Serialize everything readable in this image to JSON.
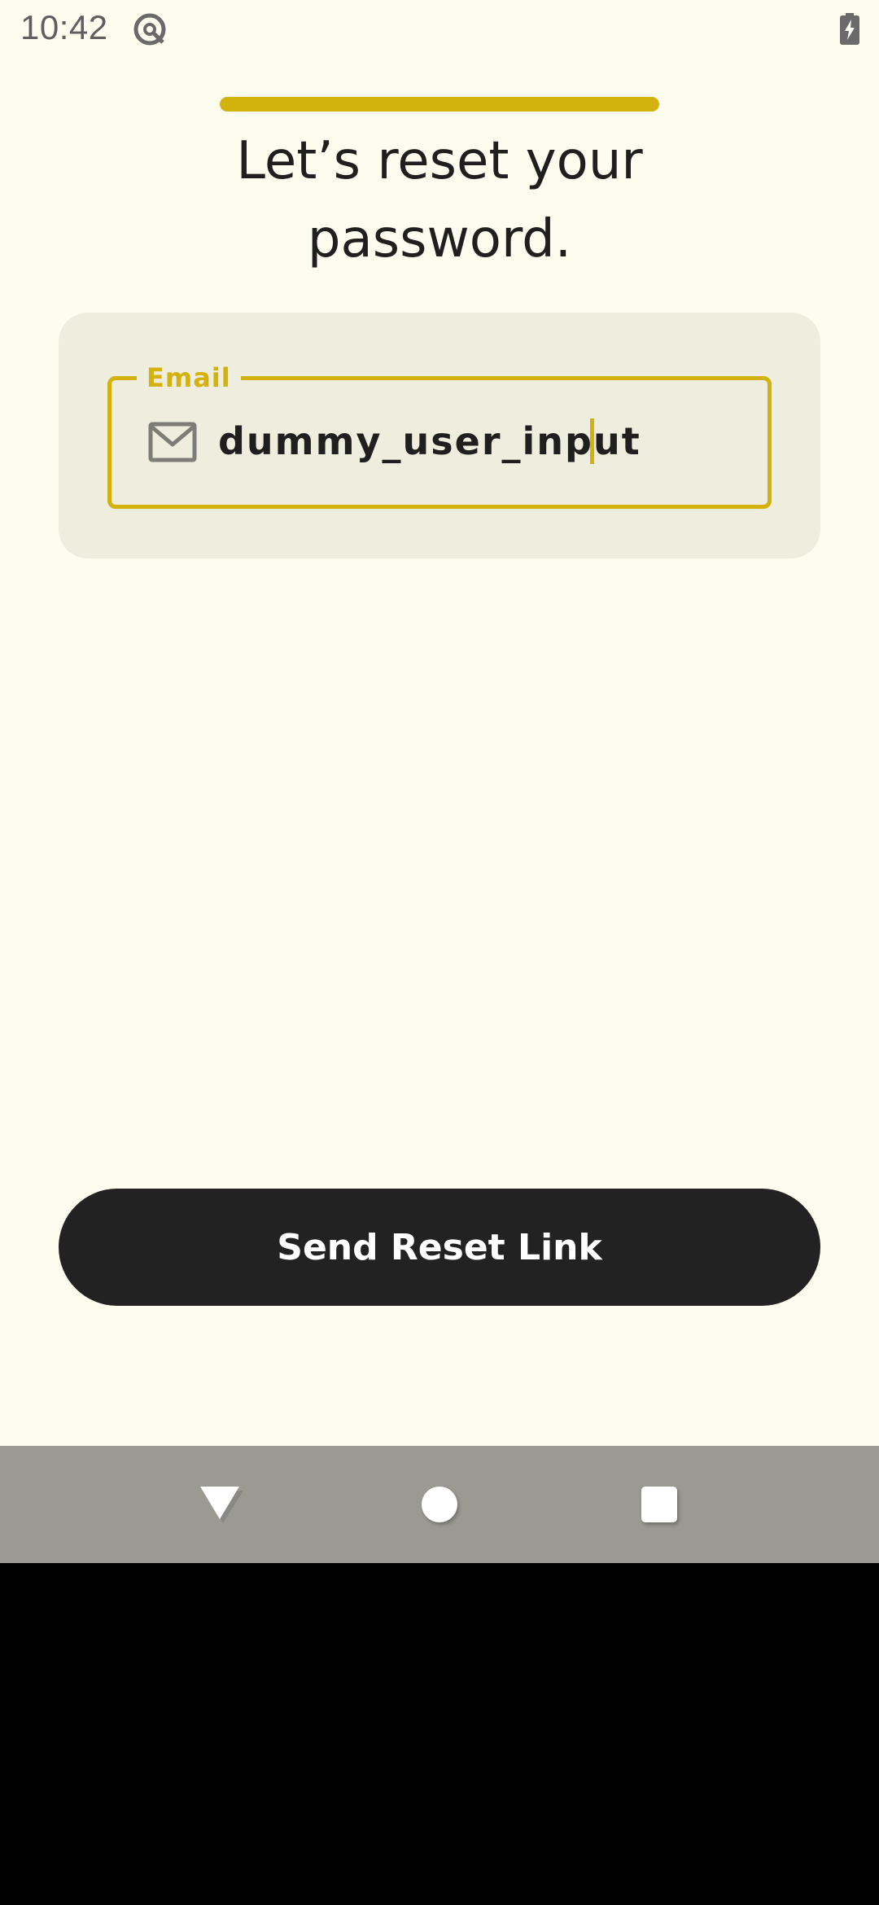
{
  "status_bar": {
    "time": "10:42",
    "app_icon": "at-sign-circle-icon",
    "battery_icon": "battery-charging-icon"
  },
  "progress": {
    "value": 1.0,
    "color": "#D4B20D"
  },
  "title": "Let’s reset your\npassword.",
  "form": {
    "email_label": "Email",
    "email_value": "dummy_user_input",
    "email_icon": "mail-icon"
  },
  "send_button_label": "Send Reset Link",
  "nav": {
    "back_icon": "back-triangle-icon",
    "home_icon": "home-circle-icon",
    "recents_icon": "recents-square-icon"
  },
  "colors": {
    "background": "#FDFDEF",
    "card": "#EEEDDE",
    "accent": "#D4B20D",
    "button": "#222222",
    "nav_bar": "#9A9A93"
  }
}
